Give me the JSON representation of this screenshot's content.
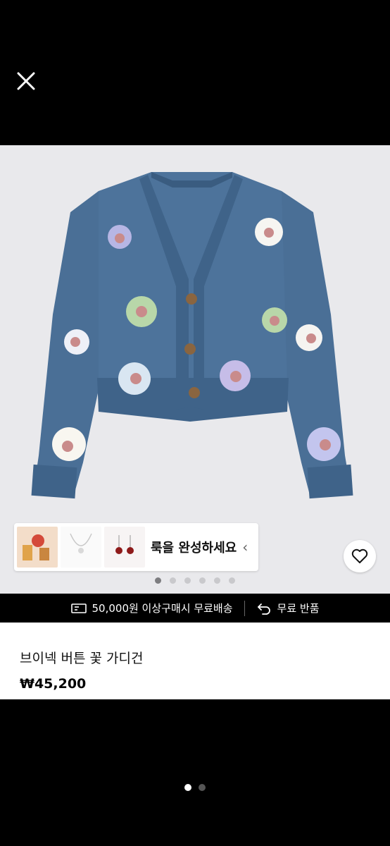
{
  "complete_look": {
    "label": "룩을 완성하세요",
    "chevron": "‹"
  },
  "carousel": {
    "total": 6,
    "active_index": 0
  },
  "promo": {
    "shipping": "50,000원 이상구매시 무료배송",
    "returns": "무료 반품"
  },
  "product": {
    "title": "브이넥 버튼 꽃 가디건",
    "price": "₩45,200"
  },
  "gallery": {
    "total": 2,
    "active_index": 0
  },
  "colors": {
    "cardigan": "#4a6f96",
    "background": "#e9e9ec"
  },
  "icons": [
    "close-icon",
    "heart-icon",
    "chevron-left-icon",
    "delivery-icon",
    "return-icon"
  ]
}
